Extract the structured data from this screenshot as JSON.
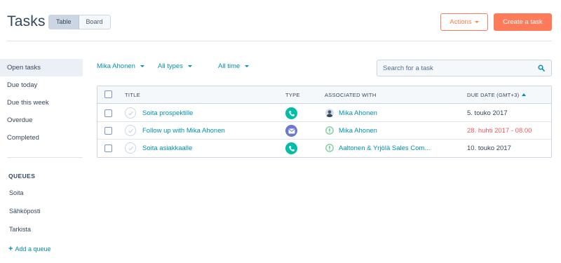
{
  "header": {
    "title": "Tasks",
    "view_table": "Table",
    "view_board": "Board",
    "actions_label": "Actions",
    "create_label": "Create a task"
  },
  "sidebar": {
    "items": [
      {
        "label": "Open tasks",
        "active": true
      },
      {
        "label": "Due today"
      },
      {
        "label": "Due this week"
      },
      {
        "label": "Overdue"
      },
      {
        "label": "Completed"
      }
    ],
    "queues_heading": "QUEUES",
    "queues": [
      "Soita",
      "Sähköposti",
      "Tarkista"
    ],
    "add_queue": "Add a queue"
  },
  "filters": {
    "owner": "Mika Ahonen",
    "type": "All types",
    "time": "All time"
  },
  "search": {
    "placeholder": "Search for a task"
  },
  "table": {
    "columns": {
      "title": "TITLE",
      "type": "TYPE",
      "associated": "ASSOCIATED WITH",
      "due": "DUE DATE (GMT+3)"
    },
    "rows": [
      {
        "title": "Soita prospektille",
        "type": "phone",
        "assoc_kind": "contact",
        "associated": "Mika Ahonen",
        "due": "5. touko 2017",
        "overdue": false
      },
      {
        "title": "Follow up with Mika Ahonen",
        "type": "email",
        "assoc_kind": "deal",
        "associated": "Mika Ahonen",
        "due": "28. huhti 2017 - 08.00",
        "overdue": true
      },
      {
        "title": "Soita asiakkaalle",
        "type": "phone",
        "assoc_kind": "deal",
        "associated": "Aaltonen & Yrjölä Sales Com...",
        "due": "10. touko 2017",
        "overdue": false
      }
    ]
  },
  "colors": {
    "accent": "#ff7a59",
    "link": "#0091ae",
    "phone": "#00bda5",
    "email": "#6a78d1",
    "overdue": "#f2545b",
    "deal": "#7fd1a4"
  }
}
